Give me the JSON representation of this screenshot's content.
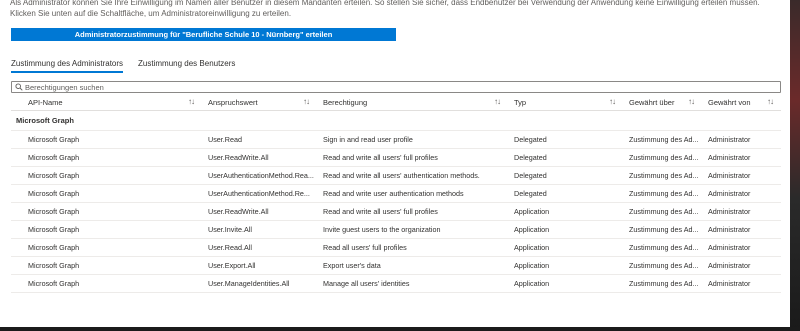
{
  "intro_text": "Als Administrator können Sie Ihre Einwilligung im Namen aller Benutzer in diesem Mandanten erteilen. So stellen Sie sicher, dass Endbenutzer bei Verwendung der Anwendung keine Einwilligung erteilen müssen. Klicken Sie unten auf die Schaltfläche, um Administratoreinwilligung zu erteilen.",
  "grant_button_label": "Administratorzustimmung für \"Berufliche Schule 10 - Nürnberg\" erteilen",
  "tabs": [
    {
      "label": "Zustimmung des Administrators",
      "active": true
    },
    {
      "label": "Zustimmung des Benutzers",
      "active": false
    }
  ],
  "search": {
    "placeholder": "Berechtigungen suchen"
  },
  "columns": {
    "api_name": "API-Name",
    "claim_value": "Anspruchswert",
    "permission": "Berechtigung",
    "type": "Typ",
    "granted_via": "Gewährt über",
    "granted_by": "Gewährt von"
  },
  "sort_icon_glyph": "↑↓",
  "group_label": "Microsoft Graph",
  "rows": [
    {
      "api": "Microsoft Graph",
      "claim": "User.Read",
      "perm": "Sign in and read user profile",
      "type": "Delegated",
      "via": "Zustimmung des Ad...",
      "by": "Administrator"
    },
    {
      "api": "Microsoft Graph",
      "claim": "User.ReadWrite.All",
      "perm": "Read and write all users' full profiles",
      "type": "Delegated",
      "via": "Zustimmung des Ad...",
      "by": "Administrator"
    },
    {
      "api": "Microsoft Graph",
      "claim": "UserAuthenticationMethod.Rea...",
      "perm": "Read and write all users' authentication methods.",
      "type": "Delegated",
      "via": "Zustimmung des Ad...",
      "by": "Administrator"
    },
    {
      "api": "Microsoft Graph",
      "claim": "UserAuthenticationMethod.Re...",
      "perm": "Read and write user authentication methods",
      "type": "Delegated",
      "via": "Zustimmung des Ad...",
      "by": "Administrator"
    },
    {
      "api": "Microsoft Graph",
      "claim": "User.ReadWrite.All",
      "perm": "Read and write all users' full profiles",
      "type": "Application",
      "via": "Zustimmung des Ad...",
      "by": "Administrator"
    },
    {
      "api": "Microsoft Graph",
      "claim": "User.Invite.All",
      "perm": "Invite guest users to the organization",
      "type": "Application",
      "via": "Zustimmung des Ad...",
      "by": "Administrator"
    },
    {
      "api": "Microsoft Graph",
      "claim": "User.Read.All",
      "perm": "Read all users' full profiles",
      "type": "Application",
      "via": "Zustimmung des Ad...",
      "by": "Administrator"
    },
    {
      "api": "Microsoft Graph",
      "claim": "User.Export.All",
      "perm": "Export user's data",
      "type": "Application",
      "via": "Zustimmung des Ad...",
      "by": "Administrator"
    },
    {
      "api": "Microsoft Graph",
      "claim": "User.ManageIdentities.All",
      "perm": "Manage all users' identities",
      "type": "Application",
      "via": "Zustimmung des Ad...",
      "by": "Administrator"
    }
  ],
  "colors": {
    "accent": "#0078d4"
  }
}
